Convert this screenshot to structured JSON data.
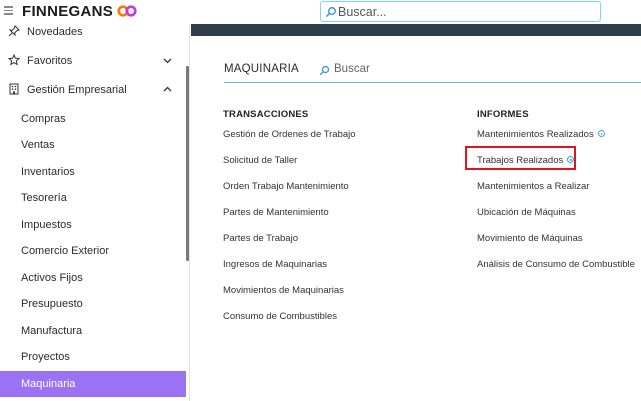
{
  "brand": {
    "name": "FINNEGANS"
  },
  "search": {
    "placeholder": "Buscar..."
  },
  "sidebar": {
    "top_items": [
      {
        "label": "Novedades",
        "icon": "pin-icon"
      },
      {
        "label": "Favoritos",
        "icon": "star-icon"
      },
      {
        "label": "Gestión Empresarial",
        "icon": "building-icon"
      }
    ],
    "items": [
      {
        "label": "Compras"
      },
      {
        "label": "Ventas"
      },
      {
        "label": "Inventarios"
      },
      {
        "label": "Tesorería"
      },
      {
        "label": "Impuestos"
      },
      {
        "label": "Comercio Exterior"
      },
      {
        "label": "Activos Fijos"
      },
      {
        "label": "Presupuesto"
      },
      {
        "label": "Manufactura"
      },
      {
        "label": "Proyectos"
      },
      {
        "label": "Maquinaria"
      }
    ],
    "active_label": "Maquinaria",
    "active_color": "#9a72f4"
  },
  "main": {
    "section_title": "MAQUINARIA",
    "search_label": "Buscar",
    "transacciones": {
      "title": "TRANSACCIONES",
      "links": [
        "Gestión de Ordenes de Trabajo",
        "Solicitud de Taller",
        "Orden Trabajo Mantenimiento",
        "Partes de Mantenimiento",
        "Partes de Trabajo",
        "Ingresos de Maquinarias",
        "Movimientos de Maquinarias",
        "Consumo de Combustibles"
      ]
    },
    "informes": {
      "title": "INFORMES",
      "links": [
        "Mantenimientos Realizados",
        "Trabajos Realizados",
        "Mantenimientos a Realizar",
        "Ubicación de Máquinas",
        "Movimiento de Máquinas",
        "Análisis de Consumo de Combustible"
      ]
    }
  }
}
